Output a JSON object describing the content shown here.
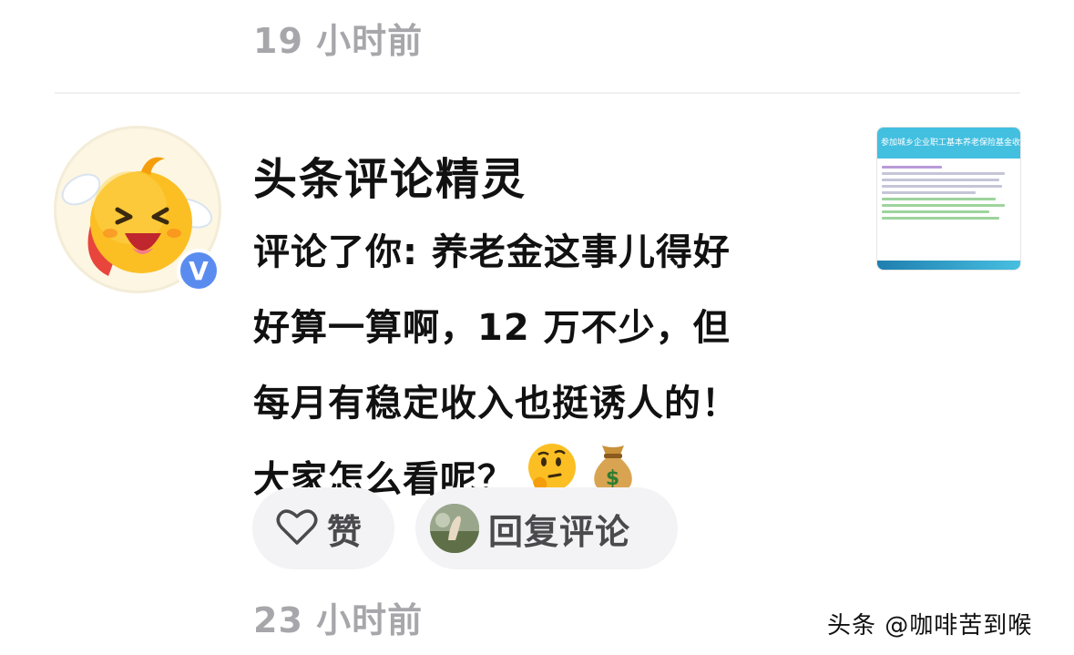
{
  "notification": {
    "previous_time": "19 小时前",
    "username": "头条评论精灵",
    "verified_badge": "V",
    "comment_lines": [
      "评论了你: 养老金这事儿得好",
      "好算一算啊，12 万不少，但",
      "每月有稳定收入也挺诱人的！",
      "大家怎么看呢？"
    ],
    "emojis": [
      "thinking-face",
      "money-bag"
    ],
    "thumbnail_caption": "参加城乡企业职工基本养老保险基金收支",
    "like_label": "赞",
    "reply_label": "回复评论",
    "time": "23 小时前"
  },
  "watermark": "头条 @咖啡苦到喉",
  "colors": {
    "time_gray": "#a7a7ab",
    "pill_background": "#f3f3f5",
    "verified_blue": "#5a8cf0",
    "thumbnail_header": "#43bfe0"
  }
}
